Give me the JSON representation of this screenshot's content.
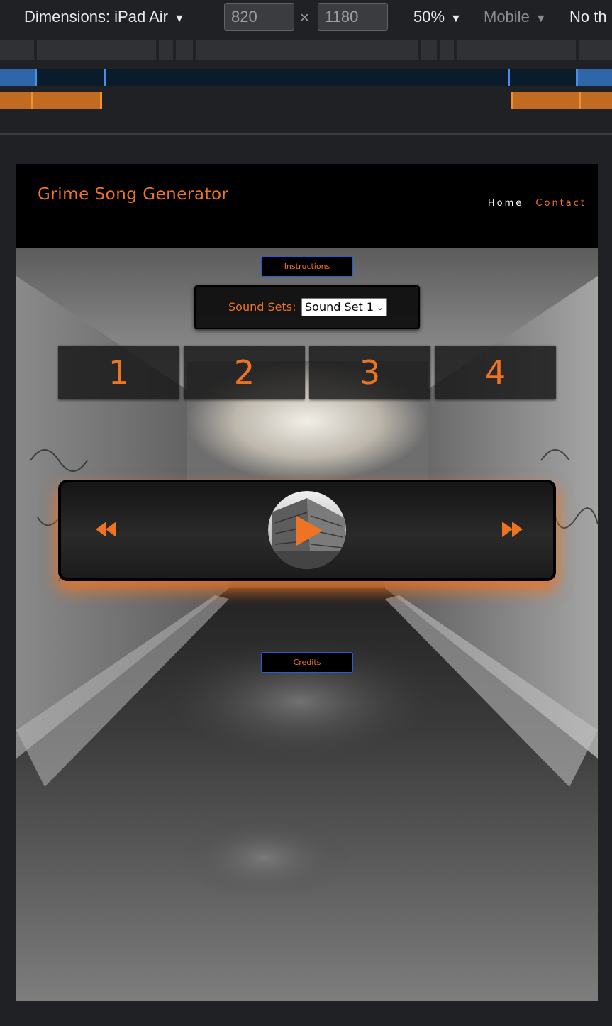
{
  "devtools": {
    "dimensions_label": "Dimensions: iPad Air",
    "width_value": "820",
    "height_value": "1180",
    "times_symbol": "×",
    "zoom": "50%",
    "mode": "Mobile",
    "throttling": "No th",
    "caret": "▼"
  },
  "site": {
    "title": "Grime Song Generator",
    "nav": [
      "Home",
      "Contact"
    ],
    "instructions_label": "Instructions",
    "sound_sets_label": "Sound Sets:",
    "sound_set_selected": "Sound Set 1",
    "loops": [
      "1",
      "2",
      "3",
      "4"
    ],
    "credits_label": "Credits"
  },
  "colors": {
    "accent": "#ee7424",
    "nav_active": "#ffffff",
    "button_border": "#2a5bd7",
    "media_query_blue": "#2e66a8",
    "media_query_orange": "#c06a22"
  },
  "icons": {
    "rewind": "rewind-icon",
    "play": "play-icon",
    "forward": "fast-forward-icon"
  }
}
